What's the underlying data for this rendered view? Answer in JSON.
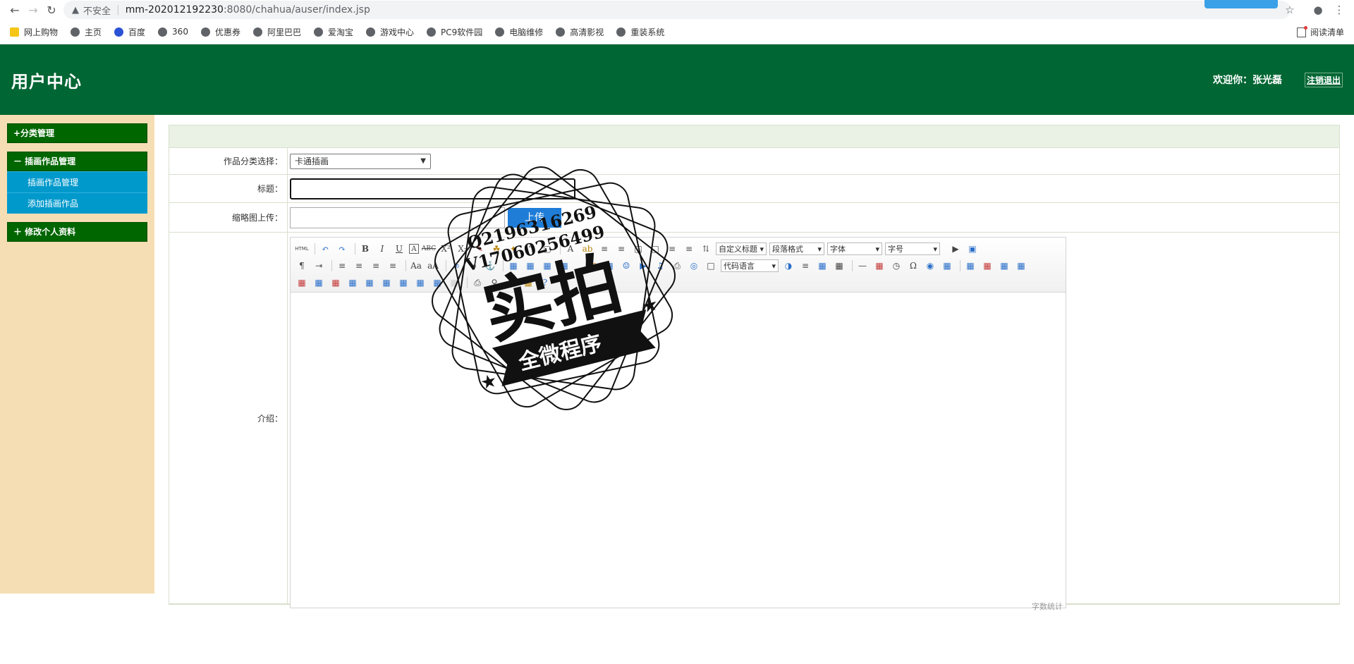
{
  "browser": {
    "url_insecure_label": "不安全",
    "url_host": "mm-202012192230",
    "url_path": ":8080/chahua/auser/index.jsp"
  },
  "bookmarks": {
    "items": [
      "网上购物",
      "主页",
      "百度",
      "360",
      "优惠券",
      "阿里巴巴",
      "爱淘宝",
      "游戏中心",
      "PC9软件园",
      "电脑维修",
      "高清影视",
      "重装系统"
    ],
    "reading_list": "阅读清单"
  },
  "header": {
    "title": "用户中心",
    "welcome": "欢迎你：张光磊",
    "logout": "注销退出"
  },
  "sidebar": {
    "groups": [
      {
        "label": "+分类管理",
        "items": []
      },
      {
        "label": "－ 插画作品管理",
        "items": [
          "插画作品管理",
          "添加插画作品"
        ]
      },
      {
        "label": "＋ 修改个人资料",
        "items": []
      }
    ]
  },
  "form": {
    "category_label": "作品分类选择：",
    "category_value": "卡通插画",
    "title_label": "标题：",
    "thumb_label": "缩略图上传：",
    "upload_button": "上传",
    "intro_label": "介绍："
  },
  "editor": {
    "row1_selects": [
      "自定义标题",
      "段落格式",
      "字体",
      "字号"
    ],
    "row2_select": "代码语言",
    "wordcount": "字数统计"
  },
  "watermark": {
    "line1": "Q2196316269",
    "line2": "V17060256499",
    "main": "实拍",
    "banner": "全微程序"
  }
}
